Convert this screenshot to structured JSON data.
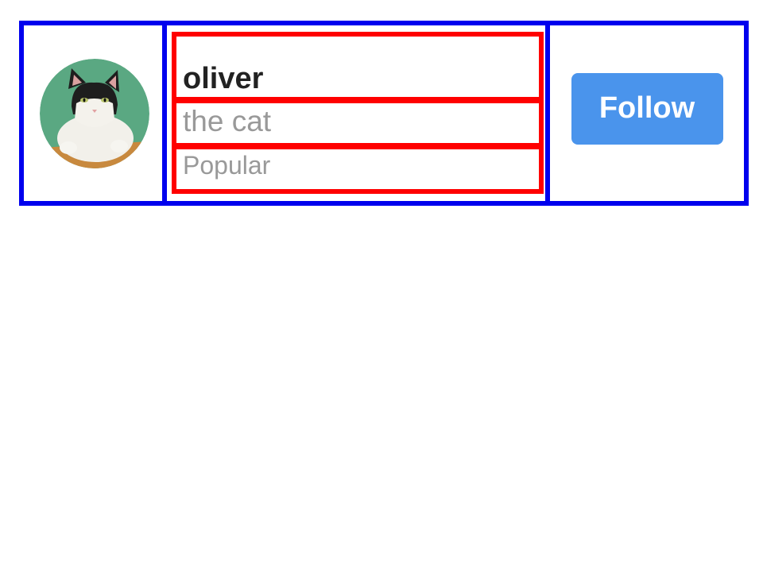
{
  "user": {
    "name": "oliver",
    "bio": "the cat",
    "tag": "Popular",
    "avatar_icon": "cat-avatar-photo"
  },
  "actions": {
    "follow_label": "Follow"
  },
  "colors": {
    "accent": "#4a94ec",
    "card_border": "#0000ee",
    "row_border": "#ff0000",
    "name_text": "#222222",
    "muted_text": "#999999",
    "avatar_bg": "#5aa882"
  }
}
